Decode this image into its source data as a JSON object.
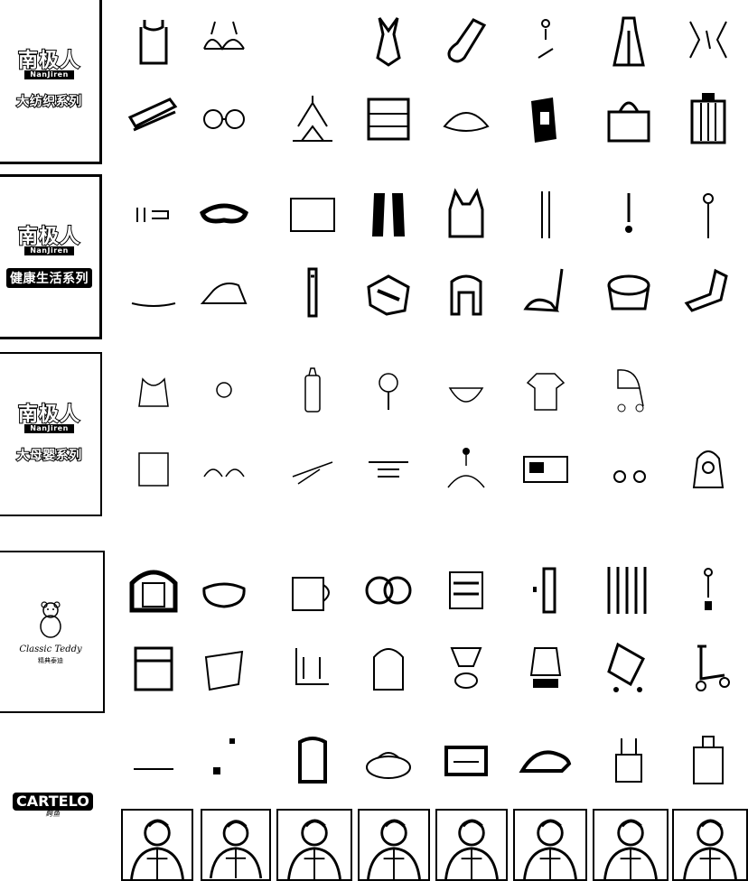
{
  "brands": [
    {
      "id": "nanjiren-textile",
      "logo_cn": "南极人",
      "logo_en": "NanJiren",
      "series": "大纺织系列",
      "series_style": "outline"
    },
    {
      "id": "nanjiren-living",
      "logo_cn": "南极人",
      "logo_en": "NanJiren",
      "series": "健康生活系列",
      "series_style": "box"
    },
    {
      "id": "nanjiren-mother",
      "logo_cn": "南极人",
      "logo_en": "NanJiren",
      "series": "大母婴系列",
      "series_style": "outline"
    },
    {
      "id": "classic-teddy",
      "script": "Classic Teddy",
      "small": "精典泰迪"
    },
    {
      "id": "cartelo",
      "logo": "CARTELO",
      "sub": "鳄鱼"
    }
  ],
  "rows": [
    {
      "icons": [
        "tank-top-icon",
        "bra-icon",
        "",
        "swimsuit-icon",
        "sock-icon",
        "earring-icon",
        "dress-icon",
        "hair-accessory-icon"
      ]
    },
    {
      "icons": [
        "scarf-icon",
        "glasses-icon",
        "lamp-icon",
        "folded-clothes-icon",
        "hat-icon",
        "belt-icon",
        "handbag-icon",
        "luggage-icon"
      ]
    },
    {
      "icons": [
        "charger-icon",
        "eye-mask-icon",
        "tablet-icon",
        "massager-icon",
        "vest-icon",
        "chopsticks-icon",
        "thermometer-icon",
        "wand-icon"
      ]
    },
    {
      "icons": [
        "mat-icon",
        "iron-icon",
        "electric-toothbrush-icon",
        "foot-massager-icon",
        "massage-chair-icon",
        "vacuum-icon",
        "foot-spa-icon",
        "recliner-icon"
      ]
    },
    {
      "icons": [
        "bib-icon",
        "pacifier-icon",
        "baby-bottle-icon",
        "rattle-icon",
        "baby-bowl-icon",
        "baby-clothes-icon",
        "stroller-icon",
        ""
      ]
    },
    {
      "icons": [
        "baby-towel-icon",
        "baby-shoes-icon",
        "baby-scale-icon",
        "baby-bath-icon",
        "crib-mobile-icon",
        "baby-blanket-icon",
        "toy-car-icon",
        "baby-carrier-icon"
      ]
    },
    {
      "icons": [
        "photo-frame-icon",
        "cushion-icon",
        "mug-icon",
        "cookies-icon",
        "container-icon",
        "flashlight-icon",
        "toothbrush-set-icon",
        "keychain-icon"
      ]
    },
    {
      "icons": [
        "storage-box-icon",
        "paper-bag-icon",
        "trolley-icon",
        "backpack-icon",
        "robot-toy-icon",
        "kids-bike-icon",
        "scooter-toy-icon",
        "kick-scooter-icon"
      ]
    },
    {
      "icons": [
        "shoe-tray-icon",
        "pendant-icon",
        "wallet-icon",
        "shoulder-bag-icon",
        "card-holder-icon",
        "leather-shoes-icon",
        "tote-bag-icon",
        "suitcase-icon"
      ]
    }
  ],
  "photos": [
    "model-photo-1",
    "model-photo-2",
    "model-photo-3",
    "model-photo-4",
    "model-photo-5",
    "model-photo-6",
    "model-photo-7",
    "model-photo-8"
  ]
}
